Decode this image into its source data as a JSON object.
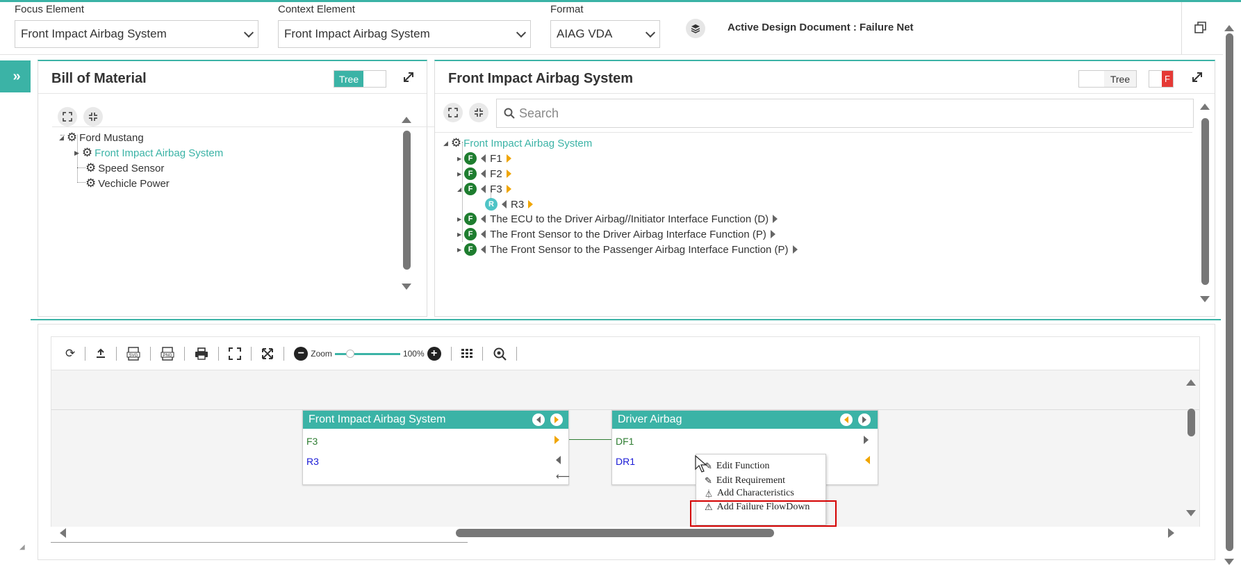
{
  "colors": {
    "accent": "#3bb3a6",
    "function_green": "#1e7d2f",
    "requirement_blue": "#1a1ad6",
    "highlight_red": "#d40000",
    "nav_orange": "#f0a500"
  },
  "header": {
    "focus_label": "Focus Element",
    "focus_value": "Front Impact Airbag System",
    "context_label": "Context Element",
    "context_value": "Front Impact Airbag System",
    "format_label": "Format",
    "format_value": "AIAG VDA",
    "active_doc": "Active Design Document : Failure Net"
  },
  "bom": {
    "title": "Bill of Material",
    "toggle_label": "Tree",
    "items": [
      {
        "label": "Ford Mustang",
        "icon": "gears-icon",
        "selected": false
      },
      {
        "label": "Front Impact Airbag System",
        "icon": "gears-icon",
        "selected": true
      },
      {
        "label": "Speed Sensor",
        "icon": "gear-icon",
        "selected": false
      },
      {
        "label": "Vechicle Power",
        "icon": "gear-icon",
        "selected": false
      }
    ]
  },
  "structure": {
    "title": "Front Impact Airbag System",
    "toggle_label": "Tree",
    "toggle_badge": "F",
    "search_placeholder": "Search",
    "root": "Front Impact Airbag System",
    "items": [
      {
        "badge": "F",
        "label": "F1"
      },
      {
        "badge": "F",
        "label": "F2"
      },
      {
        "badge": "F",
        "label": "F3"
      },
      {
        "badge": "R",
        "label": "R3"
      },
      {
        "badge": "F",
        "label": "The ECU to the Driver Airbag//Initiator Interface Function (D)"
      },
      {
        "badge": "F",
        "label": "The Front Sensor to the Driver Airbag Interface Function (P)"
      },
      {
        "badge": "F",
        "label": "The Front Sensor to the Passenger Airbag Interface Function (P)"
      }
    ]
  },
  "diagram": {
    "toolbar": {
      "zoom_label": "Zoom",
      "zoom_value": "100%",
      "svg_label": "SVG",
      "png_label": "PNG",
      "zoom_level": 0.2
    },
    "nodes": [
      {
        "title": "Front Impact Airbag System",
        "function": "F3",
        "requirement": "R3"
      },
      {
        "title": "Driver Airbag",
        "function": "DF1",
        "requirement": "DR1"
      }
    ],
    "context_menu": [
      "Edit Function",
      "Edit Requirement",
      "Add Characteristics",
      "Add Failure FlowDown"
    ]
  }
}
